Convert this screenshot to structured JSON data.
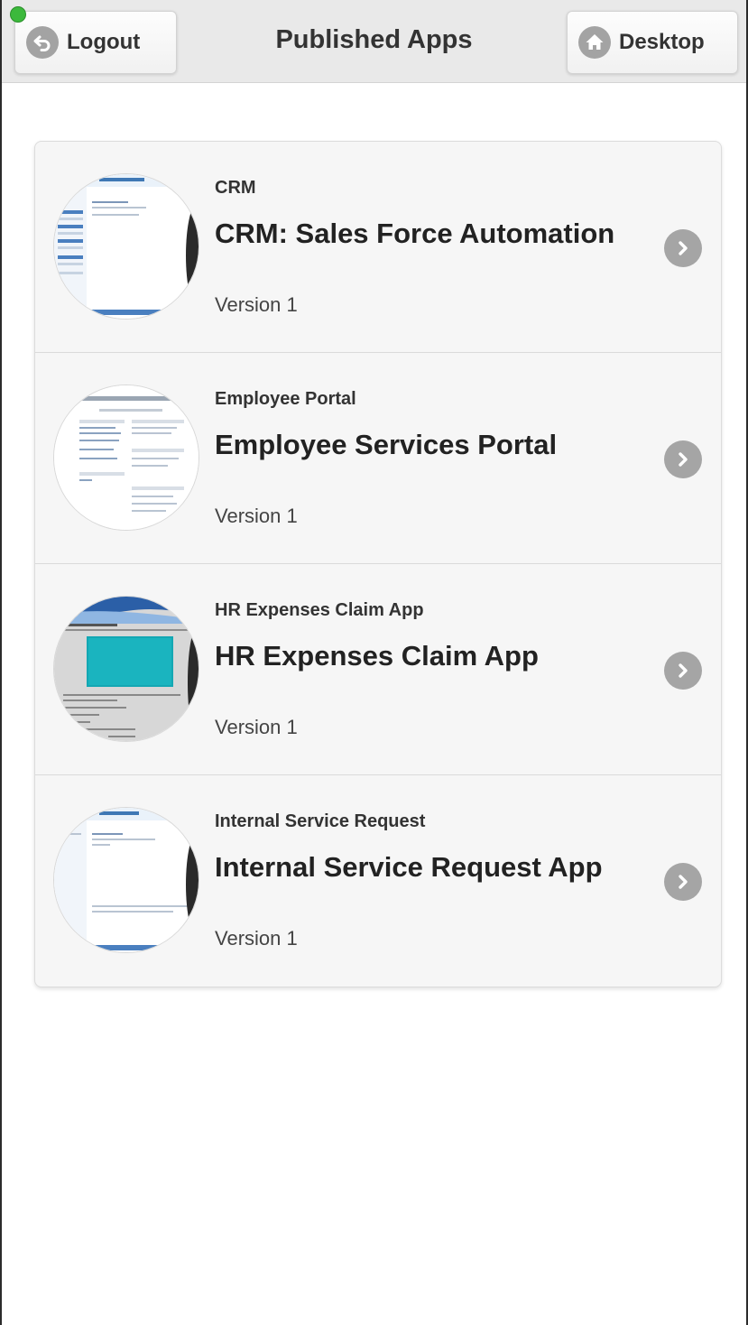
{
  "header": {
    "title": "Published Apps",
    "logout_label": "Logout",
    "desktop_label": "Desktop"
  },
  "apps": [
    {
      "category": "CRM",
      "name": "CRM: Sales Force Automation",
      "version": "Version 1"
    },
    {
      "category": "Employee Portal",
      "name": "Employee Services Portal",
      "version": "Version 1"
    },
    {
      "category": "HR Expenses Claim App",
      "name": "HR Expenses Claim App",
      "version": "Version 1"
    },
    {
      "category": "Internal Service Request",
      "name": "Internal Service Request App",
      "version": "Version 1"
    }
  ],
  "colors": {
    "header_bg": "#e9e9e9",
    "list_bg": "#f6f6f6",
    "icon_gray": "#a5a5a5",
    "status_green": "#3cb93c"
  },
  "icons": {
    "logout": "back-arrow-icon",
    "desktop": "home-icon",
    "row_action": "chevron-right-icon"
  }
}
